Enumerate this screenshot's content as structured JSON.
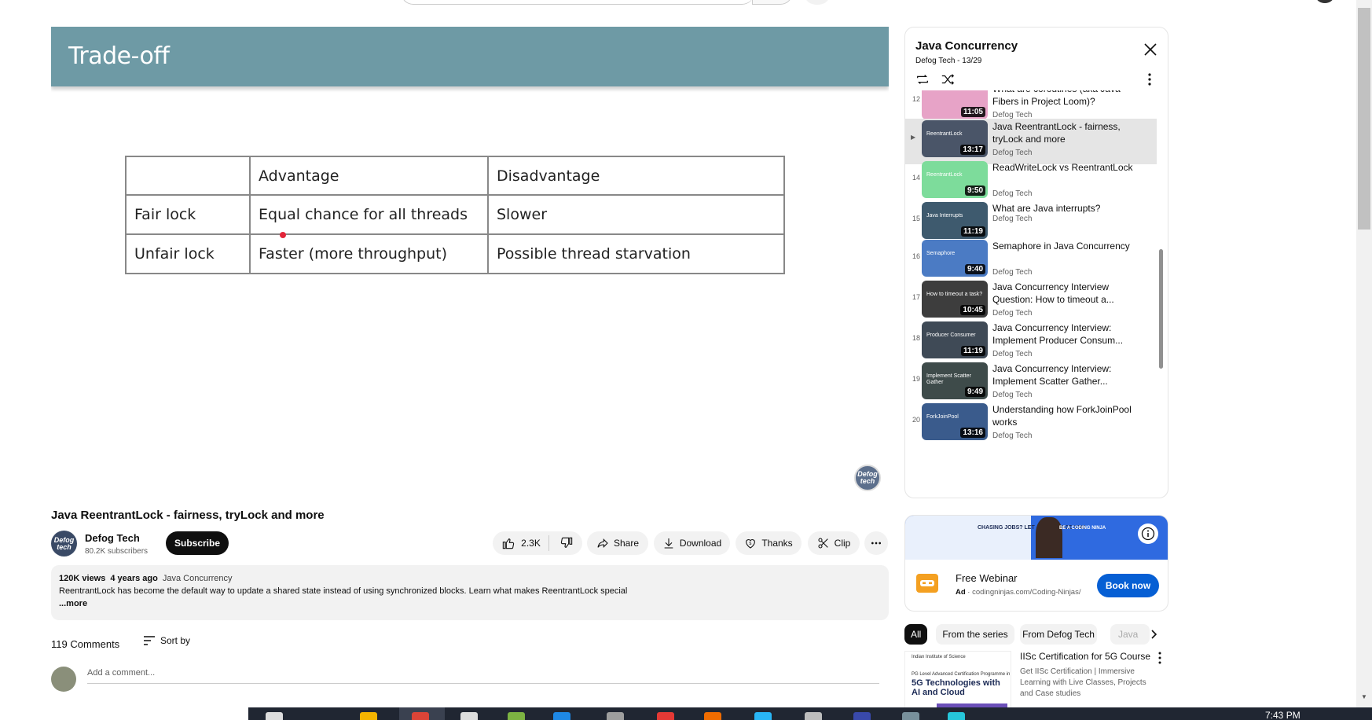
{
  "player": {
    "slide_title": "Trade-off",
    "table": {
      "header": [
        "",
        "Advantage",
        "Disadvantage"
      ],
      "rows": [
        [
          "Fair lock",
          "Equal chance for all threads",
          "Slower"
        ],
        [
          "Unfair lock",
          "Faster (more throughput)",
          "Possible thread starvation"
        ]
      ]
    },
    "watermark": "Defog tech"
  },
  "video": {
    "title": "Java ReentrantLock - fairness, tryLock and more",
    "channel_name": "Defog Tech",
    "subscribers": "80.2K subscribers",
    "channel_avatar_text": "Defog tech",
    "subscribe_label": "Subscribe",
    "like_count": "2.3K",
    "share_label": "Share",
    "download_label": "Download",
    "thanks_label": "Thanks",
    "clip_label": "Clip"
  },
  "description": {
    "views": "120K views",
    "age": "4 years ago",
    "playlist_link": "Java Concurrency",
    "text": "ReentrantLock has become the default way to update a shared state instead of using synchronized blocks. Learn what makes ReentrantLock special",
    "more_label": "...more"
  },
  "comments": {
    "count_label": "119 Comments",
    "sort_label": "Sort by",
    "placeholder": "Add a comment..."
  },
  "playlist": {
    "title": "Java Concurrency",
    "subtitle": "Defog Tech - 13/29",
    "items": [
      {
        "index": "12",
        "title": "What are coroutines (aka Java Fibers in Project Loom)?",
        "channel": "Defog Tech",
        "duration": "11:05",
        "thumb_color": "#e7a3c7",
        "thumb_label": ""
      },
      {
        "index": "",
        "title": "Java ReentrantLock - fairness, tryLock and more",
        "channel": "Defog Tech",
        "duration": "13:17",
        "thumb_color": "#4a5568",
        "thumb_label": "ReentrantLock"
      },
      {
        "index": "14",
        "title": "ReadWriteLock vs ReentrantLock",
        "channel": "Defog Tech",
        "duration": "9:50",
        "thumb_color": "#7ddc9b",
        "thumb_label": "ReentrantLock"
      },
      {
        "index": "15",
        "title": "What are Java interrupts?",
        "channel": "Defog Tech",
        "duration": "11:19",
        "thumb_color": "#3e5a6e",
        "thumb_label": "Java Interrupts"
      },
      {
        "index": "16",
        "title": "Semaphore in Java Concurrency",
        "channel": "Defog Tech",
        "duration": "9:40",
        "thumb_color": "#4b7bc4",
        "thumb_label": "Semaphore"
      },
      {
        "index": "17",
        "title": "Java Concurrency Interview Question: How to timeout a...",
        "channel": "Defog Tech",
        "duration": "10:45",
        "thumb_color": "#3d3d3d",
        "thumb_label": "How to timeout a task?"
      },
      {
        "index": "18",
        "title": "Java Concurrency Interview: Implement Producer Consum...",
        "channel": "Defog Tech",
        "duration": "11:19",
        "thumb_color": "#3f4a56",
        "thumb_label": "Producer Consumer"
      },
      {
        "index": "19",
        "title": "Java Concurrency Interview: Implement Scatter Gather...",
        "channel": "Defog Tech",
        "duration": "9:49",
        "thumb_color": "#3e4b4a",
        "thumb_label": "Implement Scatter Gather"
      },
      {
        "index": "20",
        "title": "Understanding how ForkJoinPool works",
        "channel": "Defog Tech",
        "duration": "13:16",
        "thumb_color": "#3a5b8c",
        "thumb_label": "ForkJoinPool"
      }
    ]
  },
  "ad": {
    "banner_left": "CHASING JOBS? LET JOBS CHASE YOU.",
    "banner_right": "BE A CODING NINJA",
    "title": "Free Webinar",
    "ad_label": "Ad",
    "url": "codingninjas.com/Coding-Ninjas/",
    "cta_label": "Book now"
  },
  "chips": {
    "all": "All",
    "series": "From the series",
    "defog": "From Defog Tech",
    "partial": "Java"
  },
  "recommended": {
    "thumb_head": "Indian Institute of Science",
    "thumb_line": "PG Level Advanced Certification Programme in",
    "thumb_title": "5G Technologies with AI and Cloud",
    "title": "IISc Certification for 5G Course",
    "description": "Get IISc Certification | Immersive Learning with Live Classes, Projects and Case studies"
  },
  "taskbar": {
    "clock": "7:43 PM"
  },
  "colors": {
    "slide_header": "#6e9aa5",
    "subscribe_bg": "#0f0f0f",
    "ad_cta": "#065fd4"
  }
}
